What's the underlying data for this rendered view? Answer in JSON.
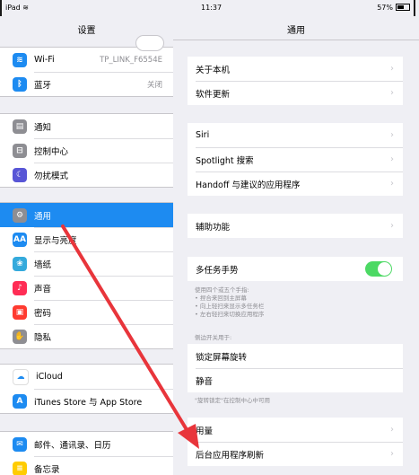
{
  "status_bar": {
    "device": "iPad",
    "wifi_icon": "wifi-icon",
    "time": "11:37",
    "battery": "57%"
  },
  "left": {
    "title": "设置",
    "group1": [
      {
        "label": "Wi-Fi",
        "value": "TP_LINK_F6554E",
        "icon": "wifi-icon",
        "color": "#1d8bf1",
        "glyph": "≋"
      },
      {
        "label": "蓝牙",
        "value": "关闭",
        "icon": "bluetooth-icon",
        "color": "#1d8bf1",
        "glyph": "ᛒ"
      }
    ],
    "group2": [
      {
        "label": "通知",
        "icon": "notification-icon",
        "color": "#8e8e93",
        "glyph": "▤"
      },
      {
        "label": "控制中心",
        "icon": "control-center-icon",
        "color": "#8e8e93",
        "glyph": "⊟"
      },
      {
        "label": "勿扰模式",
        "icon": "moon-icon",
        "color": "#5856d6",
        "glyph": "☾"
      }
    ],
    "group3": [
      {
        "label": "通用",
        "icon": "gear-icon",
        "color": "#8e8e93",
        "glyph": "⚙",
        "selected": true
      },
      {
        "label": "显示与亮度",
        "icon": "display-icon",
        "color": "#1d8bf1",
        "glyph": "AA"
      },
      {
        "label": "墙纸",
        "icon": "wallpaper-icon",
        "color": "#34aadc",
        "glyph": "❀"
      },
      {
        "label": "声音",
        "icon": "sound-icon",
        "color": "#ff2d55",
        "glyph": "♪"
      },
      {
        "label": "密码",
        "icon": "passcode-icon",
        "color": "#ff3b30",
        "glyph": "▣"
      },
      {
        "label": "隐私",
        "icon": "privacy-icon",
        "color": "#8e8e93",
        "glyph": "✋"
      }
    ],
    "group4": [
      {
        "label": "iCloud",
        "icon": "cloud-icon",
        "color": "#ffffff",
        "glyph": "☁"
      },
      {
        "label": "iTunes Store 与 App Store",
        "icon": "app-store-icon",
        "color": "#1d8bf1",
        "glyph": "A"
      }
    ],
    "group5": [
      {
        "label": "邮件、通讯录、日历",
        "icon": "mail-icon",
        "color": "#1d8bf1",
        "glyph": "✉"
      },
      {
        "label": "备忘录",
        "icon": "notes-icon",
        "color": "#ffcc00",
        "glyph": "≡"
      }
    ]
  },
  "right": {
    "title": "通用",
    "groupA": [
      "关于本机",
      "软件更新"
    ],
    "groupB": [
      "Siri",
      "Spotlight 搜索",
      "Handoff 与建议的应用程序"
    ],
    "groupC": [
      "辅助功能"
    ],
    "multitask": {
      "label": "多任务手势",
      "on": true
    },
    "multitask_note": [
      "使用四个或五个手指:",
      "• 捏合来回到主屏幕",
      "• 向上轻扫来显示多任务栏",
      "• 左右轻扫来切换应用程序"
    ],
    "side_switch_header": "侧边开关用于:",
    "side_switch_rows": [
      "锁定屏幕旋转",
      "静音"
    ],
    "side_switch_note": "\"旋转锁定\"在控制中心中可用",
    "groupD": [
      "用量",
      "后台应用程序刷新"
    ]
  },
  "colors": {
    "accent": "#1d8bf1",
    "switch_on": "#4cd964",
    "arrow": "#e8353b"
  }
}
